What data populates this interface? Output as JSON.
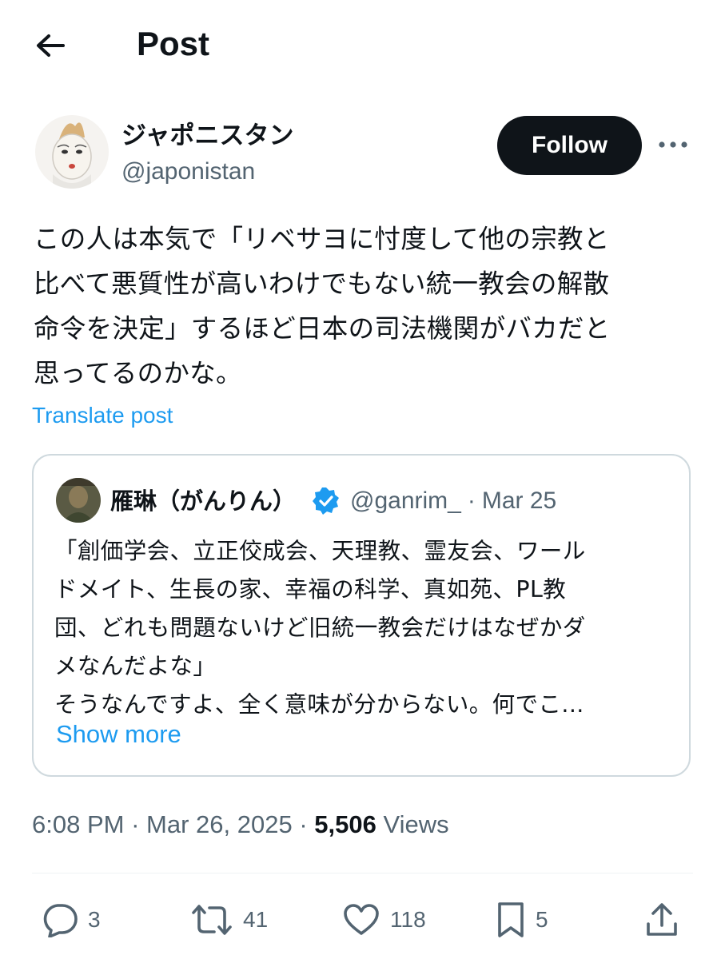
{
  "header": {
    "title": "Post"
  },
  "author": {
    "name": "ジャポニスタン",
    "handle": "@japonistan",
    "follow_label": "Follow"
  },
  "post": {
    "lines": [
      "この人は本気で「リベサヨに忖度して他の宗教と",
      "比べて悪質性が高いわけでもない統一教会の解散",
      "命令を決定」するほど日本の司法機関がバカだと",
      "思ってるのかな。"
    ],
    "translate_label": "Translate post"
  },
  "quote": {
    "name": "雁琳（がんりん）",
    "handle": "@ganrim_",
    "separator": "·",
    "date": "Mar 25",
    "lines": [
      "「創価学会、立正佼成会、天理教、霊友会、ワール",
      "ドメイト、生長の家、幸福の科学、真如苑、PL教",
      "団、どれも問題ないけど旧統一教会だけはなぜかダ",
      "メなんだよな」",
      "そうなんですよ、全く意味が分からない。何でこ..."
    ],
    "show_more_label": "Show more"
  },
  "meta": {
    "time": "6:08 PM",
    "separator": "·",
    "date": "Mar 26, 2025",
    "views_count": "5,506",
    "views_label": "Views"
  },
  "actions": {
    "replies": "3",
    "reposts": "41",
    "likes": "118",
    "bookmarks": "5"
  },
  "colors": {
    "accent": "#1d9bf0",
    "text": "#0f1419",
    "muted": "#536471",
    "border": "#cfd9de"
  },
  "icons": [
    "arrow-left-icon",
    "more-dots-icon",
    "verified-badge-icon",
    "reply-icon",
    "repost-icon",
    "like-icon",
    "bookmark-icon",
    "share-icon"
  ]
}
